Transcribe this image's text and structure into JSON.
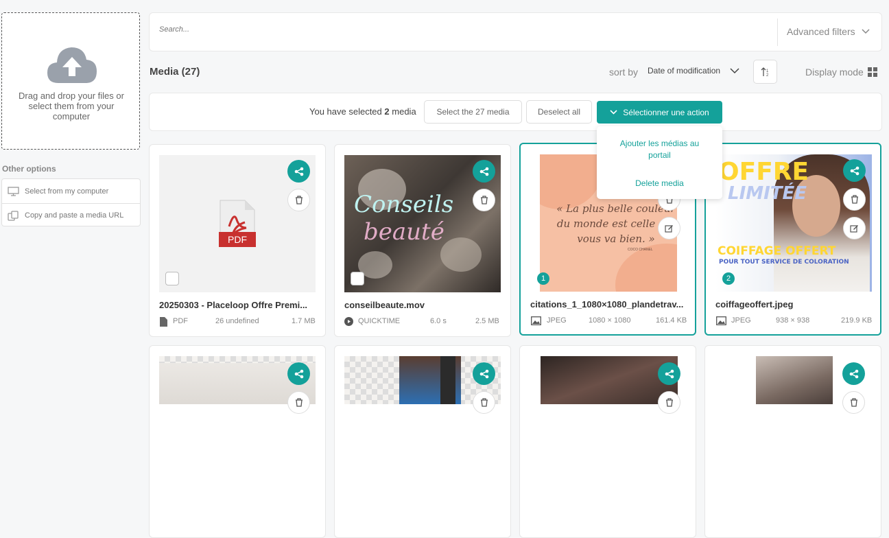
{
  "upload": {
    "text": "Drag and drop your files or select them from your computer"
  },
  "other_options": {
    "title": "Other options",
    "select_computer": "Select from my computer",
    "paste_url": "Copy and paste a media URL"
  },
  "search": {
    "placeholder": "Search...",
    "advanced_filters": "Advanced filters"
  },
  "media": {
    "title": "Media (27)"
  },
  "sort": {
    "label": "sort by",
    "value": "Date of modification"
  },
  "display_mode": "Display mode",
  "selection": {
    "prefix": "You have selected",
    "count": "2",
    "suffix": "media",
    "select_all": "Select the 27 media",
    "deselect_all": "Deselect all",
    "action": "Sélectionner une action"
  },
  "actions_menu": {
    "add_portal": "Ajouter les médias au portail",
    "delete": "Delete media"
  },
  "cards": [
    {
      "name": "20250303 - Placeloop Offre Premi...",
      "type": "PDF",
      "meta": "26 undefined",
      "size": "1.7 MB"
    },
    {
      "name": "conseilbeaute.mov",
      "type": "QUICKTIME",
      "meta": "6.0 s",
      "size": "2.5 MB",
      "thumb_text1": "Conseils",
      "thumb_text2": "beauté"
    },
    {
      "name": "citations_1_1080×1080_plandetrav...",
      "type": "JPEG",
      "meta": "1080 × 1080",
      "size": "161.4 KB",
      "badge": "1",
      "quote": "« La plus belle couleur du monde est celle qui vous va bien. »",
      "quote_author": "COCO CHANEL"
    },
    {
      "name": "coiffageoffert.jpeg",
      "type": "JPEG",
      "meta": "938 × 938",
      "size": "219.9 KB",
      "badge": "2",
      "thumb_t1": "OFFRE",
      "thumb_t2": "LIMITÉE",
      "thumb_t3": "COIFFAGE OFFERT",
      "thumb_t4": "POUR TOUT SERVICE DE COLORATION"
    }
  ],
  "colors": {
    "accent": "#14a19a",
    "pdf": "#c8312f"
  }
}
